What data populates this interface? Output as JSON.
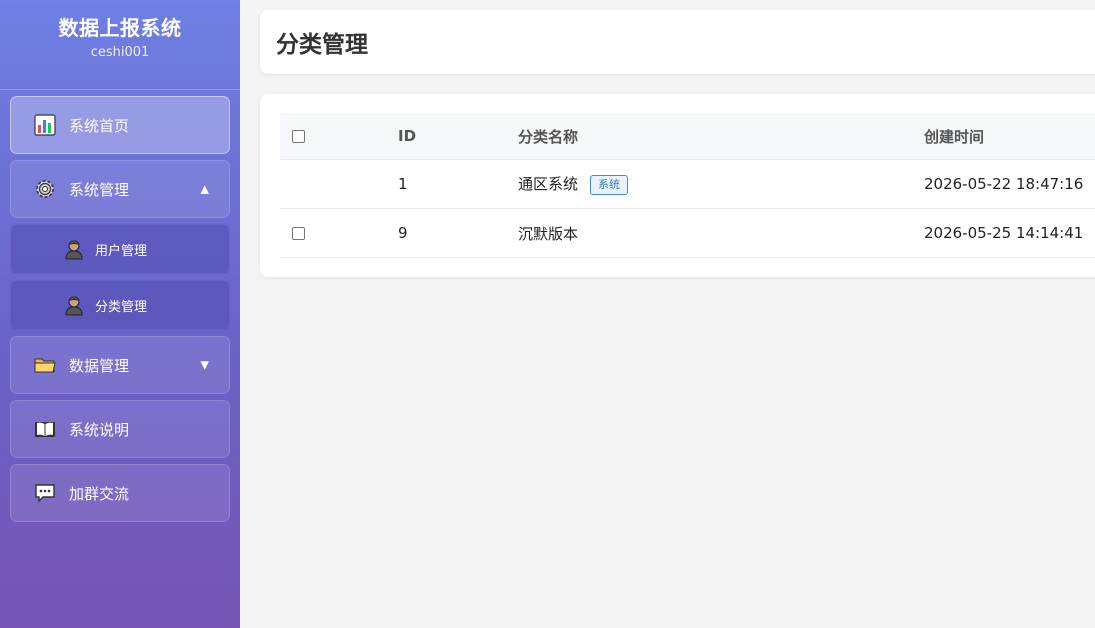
{
  "app": {
    "title": "数据上报系统",
    "user": "ceshi001"
  },
  "sidebar": {
    "items": [
      {
        "label": "系统首页",
        "icon": "bar-chart-icon"
      },
      {
        "label": "系统管理",
        "icon": "gear-icon",
        "arrow": "▲"
      },
      {
        "label": "用户管理",
        "icon": "user-icon"
      },
      {
        "label": "分类管理",
        "icon": "user-icon"
      },
      {
        "label": "数据管理",
        "icon": "folder-icon",
        "arrow": "▼"
      },
      {
        "label": "系统说明",
        "icon": "book-icon"
      },
      {
        "label": "加群交流",
        "icon": "speech-bubble-icon"
      }
    ]
  },
  "main": {
    "page_title": "分类管理",
    "table": {
      "headers": [
        "",
        "ID",
        "分类名称",
        "创建时间"
      ],
      "rows": [
        {
          "id": "1",
          "name": "通区系统",
          "tag": "系统",
          "created": "2026-05-22 18:47:16"
        },
        {
          "id": "9",
          "name": "沉默版本",
          "created": "2026-05-25 14:14:41"
        }
      ]
    }
  },
  "colors": {
    "accent": "#6f7fe3",
    "sidebar_bottom": "#7654b4",
    "tag": "#3a78c0"
  }
}
